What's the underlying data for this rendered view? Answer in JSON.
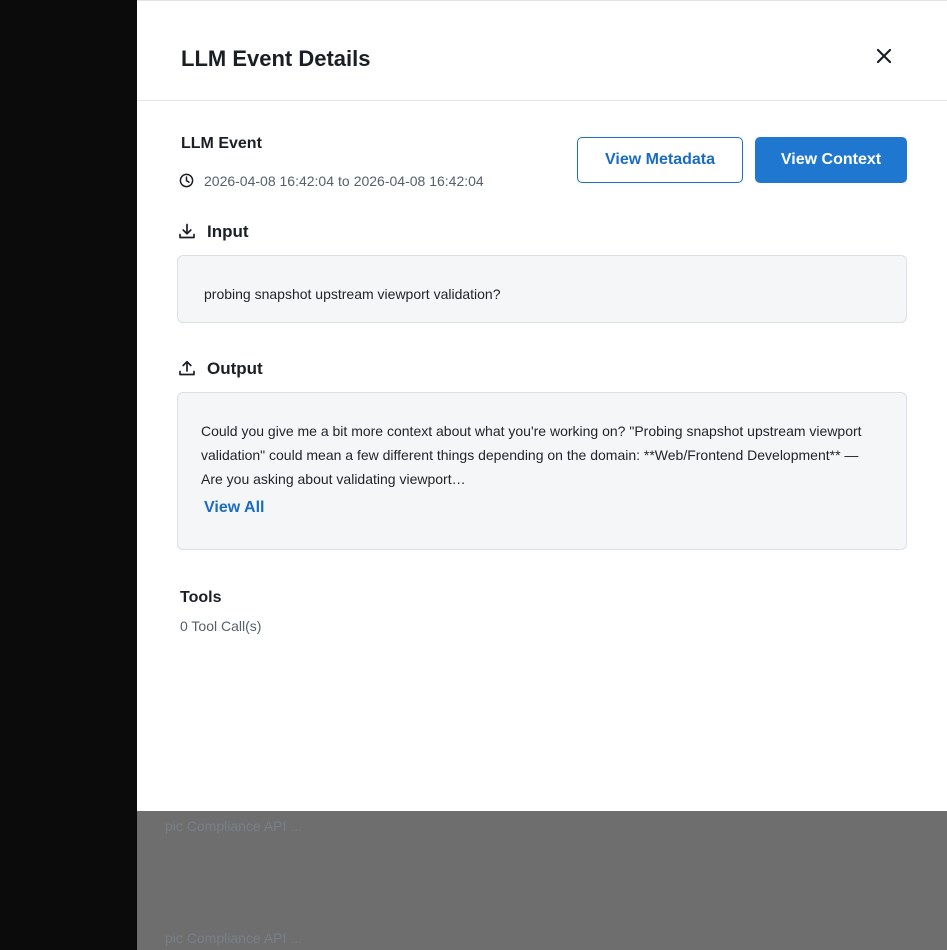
{
  "drawer": {
    "title": "LLM Event Details",
    "close_icon": "close-icon"
  },
  "event": {
    "title": "LLM Event",
    "time_icon": "clock-icon",
    "start": "2026-04-08 16:42:04",
    "to": "to",
    "end": "2026-04-08 16:42:04"
  },
  "actions": {
    "view_metadata": "View Metadata",
    "view_context": "View Context"
  },
  "input": {
    "icon": "download-icon",
    "label": "Input",
    "text": "probing snapshot upstream viewport validation?"
  },
  "output": {
    "icon": "upload-icon",
    "label": "Output",
    "text": "Could you give me a bit more context about what you're working on? \"Probing snapshot upstream viewport validation\" could mean a few different things depending on the domain: **Web/Frontend Development** — Are you asking about validating viewport…",
    "view_all": "View All"
  },
  "tools": {
    "title": "Tools",
    "count": "0 Tool Call(s)"
  },
  "background": {
    "row1": "pic Compliance API ...",
    "row2": "pic Compliance API ..."
  },
  "colors": {
    "accent": "#1f77d0",
    "panel_bg": "#f5f6f8",
    "backdrop": "#6e6e6e"
  }
}
